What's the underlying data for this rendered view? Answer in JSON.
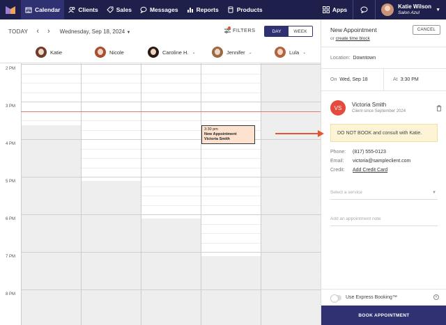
{
  "nav": {
    "items": [
      {
        "label": "Calendar",
        "icon": "calendar-icon",
        "active": true
      },
      {
        "label": "Clients",
        "icon": "clients-icon",
        "active": false
      },
      {
        "label": "Sales",
        "icon": "tag-icon",
        "active": false
      },
      {
        "label": "Messages",
        "icon": "chat-icon",
        "active": false
      },
      {
        "label": "Reports",
        "icon": "chart-icon",
        "active": false
      },
      {
        "label": "Products",
        "icon": "box-icon",
        "active": false
      }
    ],
    "apps_label": "Apps",
    "user_name": "Katie Wilson",
    "user_salon": "Salon Azul"
  },
  "toolbar": {
    "today_label": "TODAY",
    "date_label": "Wednesday, Sep 18, 2024",
    "filters_label": "FILTERS",
    "view_day": "DAY",
    "view_week": "WEEK"
  },
  "staff": [
    {
      "name": "Katie",
      "hair": "#6b3f2a"
    },
    {
      "name": "Nicole",
      "hair": "#a4512f"
    },
    {
      "name": "Caroline H.",
      "hair": "#2a1c14"
    },
    {
      "name": "Jennifer",
      "hair": "#9a6a45"
    },
    {
      "name": "Lula",
      "hair": "#b2623d"
    }
  ],
  "times": [
    "2 PM",
    "3 PM",
    "4 PM",
    "5 PM",
    "6 PM",
    "7 PM",
    "8 PM"
  ],
  "appointment": {
    "time": "3:30 pm",
    "title": "New Appointment",
    "client": "Victoria Smith"
  },
  "panel": {
    "title": "New Appointment",
    "sub_prefix": "or",
    "sub_link": "create time block",
    "cancel_label": "CANCEL",
    "location_label": "Location:",
    "location_value": "Downtown",
    "on_label": "On",
    "on_value": "Wed, Sep 18",
    "at_label": "At",
    "at_value": "3:30 PM",
    "client_initials": "VS",
    "client_name": "Victoria Smith",
    "client_since": "Client since September 2024",
    "alert": "DO NOT BOOK and consult with Katie.",
    "phone_label": "Phone:",
    "phone_value": "(817) 555-0123",
    "email_label": "Email:",
    "email_value": "victoria@sampleclient.com",
    "credit_label": "Credit:",
    "credit_value": "Add Credit Card",
    "service_placeholder": "Select a service",
    "note_placeholder": "Add an appointment note",
    "express_label": "Use Express Booking™",
    "book_label": "BOOK APPOINTMENT"
  },
  "colors": {
    "nav_bg": "#1e1f4b",
    "accent": "#2f3173",
    "alert_red": "#e4572e",
    "appointment_bg": "#fde3cf"
  }
}
